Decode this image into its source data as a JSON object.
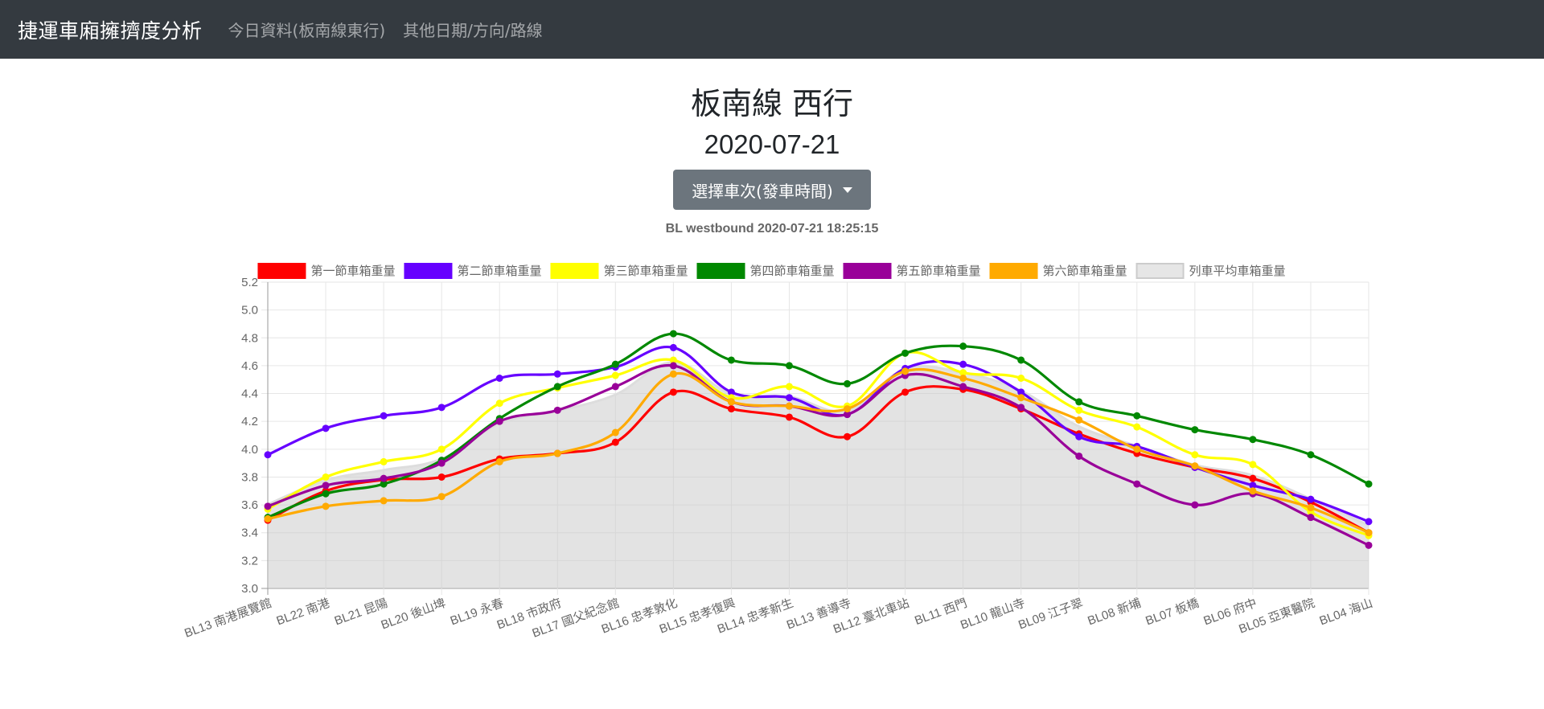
{
  "navbar": {
    "brand": "捷運車廂擁擠度分析",
    "links": [
      "今日資料(板南線東行)",
      "其他日期/方向/路線"
    ]
  },
  "page": {
    "title": "板南線 西行",
    "date": "2020-07-21",
    "dropdown_label": "選擇車次(發車時間)"
  },
  "chart_data": {
    "type": "line",
    "title": "BL westbound 2020-07-21 18:25:15",
    "xlabel": "",
    "ylabel": "",
    "ylim": [
      3.0,
      5.2
    ],
    "yticks": [
      "3.0",
      "3.2",
      "3.4",
      "3.6",
      "3.8",
      "4.0",
      "4.2",
      "4.4",
      "4.6",
      "4.8",
      "5.0",
      "5.2"
    ],
    "grid": true,
    "legend_position": "top",
    "categories": [
      "BL13 南港展覽館",
      "BL22 南港",
      "BL21 昆陽",
      "BL20 後山埤",
      "BL19 永春",
      "BL18 市政府",
      "BL17 國父紀念館",
      "BL16 忠孝敦化",
      "BL15 忠孝復興",
      "BL14 忠孝新生",
      "BL13 善導寺",
      "BL12 臺北車站",
      "BL11 西門",
      "BL10 龍山寺",
      "BL09 江子翠",
      "BL08 新埔",
      "BL07 板橋",
      "BL06 府中",
      "BL05 亞東醫院",
      "BL04 海山"
    ],
    "series": [
      {
        "name": "第一節車箱重量",
        "color": "#ff0000",
        "values": [
          3.49,
          3.7,
          3.78,
          3.8,
          3.93,
          3.97,
          4.05,
          4.41,
          4.29,
          4.23,
          4.09,
          4.41,
          4.43,
          4.29,
          4.11,
          3.97,
          3.87,
          3.79,
          3.62,
          3.4
        ]
      },
      {
        "name": "第二節車箱重量",
        "color": "#6600ff",
        "values": [
          3.96,
          4.15,
          4.24,
          4.3,
          4.51,
          4.54,
          4.59,
          4.73,
          4.41,
          4.37,
          4.25,
          4.58,
          4.61,
          4.41,
          4.09,
          4.02,
          3.87,
          3.74,
          3.64,
          3.48
        ]
      },
      {
        "name": "第三節車箱重量",
        "color": "#ffff00",
        "values": [
          3.57,
          3.8,
          3.91,
          4.0,
          4.33,
          4.44,
          4.53,
          4.64,
          4.37,
          4.45,
          4.31,
          4.69,
          4.55,
          4.51,
          4.28,
          4.16,
          3.96,
          3.89,
          3.55,
          3.38
        ]
      },
      {
        "name": "第四節車箱重量",
        "color": "#008800",
        "values": [
          3.51,
          3.68,
          3.75,
          3.92,
          4.22,
          4.45,
          4.61,
          4.83,
          4.64,
          4.6,
          4.47,
          4.69,
          4.74,
          4.64,
          4.34,
          4.24,
          4.14,
          4.07,
          3.96,
          3.75
        ]
      },
      {
        "name": "第五節車箱重量",
        "color": "#990099",
        "values": [
          3.59,
          3.74,
          3.79,
          3.9,
          4.2,
          4.28,
          4.45,
          4.6,
          4.34,
          4.31,
          4.25,
          4.53,
          4.45,
          4.3,
          3.95,
          3.75,
          3.6,
          3.68,
          3.51,
          3.31
        ]
      },
      {
        "name": "第六節車箱重量",
        "color": "#ffaa00",
        "values": [
          3.5,
          3.59,
          3.63,
          3.66,
          3.91,
          3.97,
          4.12,
          4.54,
          4.34,
          4.31,
          4.29,
          4.56,
          4.51,
          4.37,
          4.21,
          4.0,
          3.88,
          3.7,
          3.58,
          3.4
        ]
      }
    ],
    "average_series": {
      "name": "列車平均車箱重量",
      "color": "#cccccc",
      "fill": "rgba(200,200,200,0.5)"
    }
  }
}
